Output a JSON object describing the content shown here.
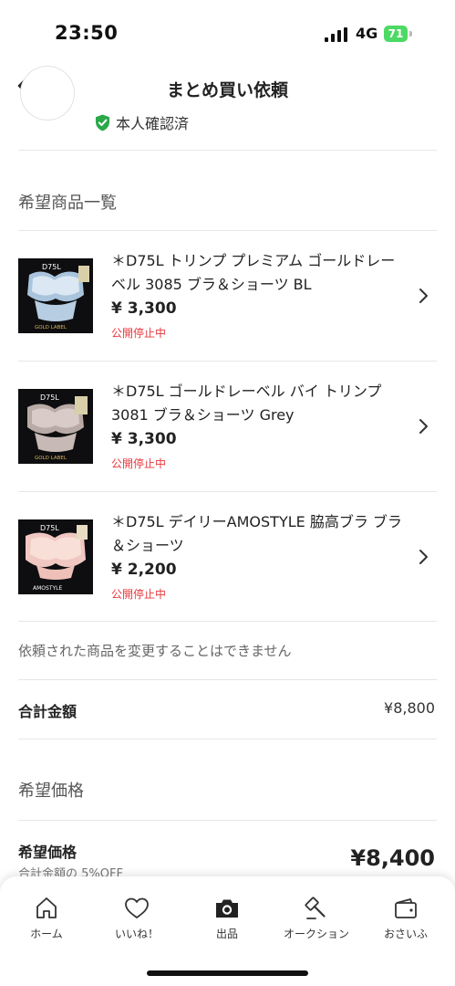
{
  "status_bar": {
    "time": "23:50",
    "network": "4G",
    "battery": "71"
  },
  "nav": {
    "title": "まとめ買い依頼",
    "back_icon": "chevron-left-icon"
  },
  "seller": {
    "verified_label": "本人確認済",
    "verified_icon": "shield-check-icon",
    "accent_color": "#2aa84a"
  },
  "items_section": {
    "title": "希望商品一覧",
    "items": [
      {
        "name": "＊D75L トリンプ プレミアム ゴールドレーベル 3085 ブラ＆ショーツ BL",
        "price": "¥ 3,300",
        "status": "公開停止中",
        "thumb_tag": "D75L",
        "thumb_brand": "GOLD LABEL"
      },
      {
        "name": "＊D75L ゴールドレーベル バイ トリンプ3081 ブラ＆ショーツ Grey",
        "price": "¥ 3,300",
        "status": "公開停止中",
        "thumb_tag": "D75L",
        "thumb_brand": "GOLD LABEL"
      },
      {
        "name": "＊D75L デイリーAMOSTYLE 脇高ブラ ブラ＆ショーツ",
        "price": "¥ 2,200",
        "status": "公開停止中",
        "thumb_tag": "D75L",
        "thumb_brand": "AMOSTYLE"
      }
    ]
  },
  "notice": "依頼された商品を変更することはできません",
  "total": {
    "label": "合計金額",
    "value": "¥8,800"
  },
  "wish_section": {
    "title": "希望価格",
    "label": "希望価格",
    "sub": "合計金額の 5%OFF",
    "value": "¥8,400"
  },
  "tab_bar": {
    "tabs": [
      {
        "label": "ホーム",
        "icon": "home-icon"
      },
      {
        "label": "いいね！",
        "icon": "heart-icon"
      },
      {
        "label": "出品",
        "icon": "camera-icon"
      },
      {
        "label": "オークション",
        "icon": "gavel-icon"
      },
      {
        "label": "おさいふ",
        "icon": "wallet-icon"
      }
    ]
  },
  "colors": {
    "status_red": "#e8383d",
    "text": "#222222",
    "divider": "#e6e6e6"
  }
}
